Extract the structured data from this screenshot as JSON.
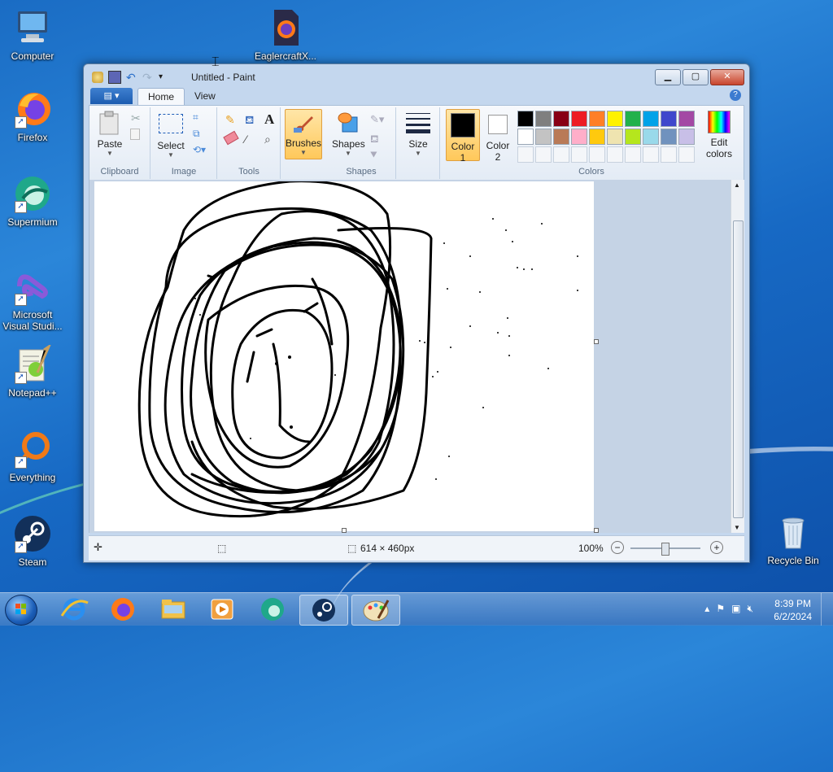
{
  "desktop": {
    "icons": [
      {
        "label": "Computer"
      },
      {
        "label": "EaglercraftX..."
      },
      {
        "label": "Firefox"
      },
      {
        "label": "Supermium"
      },
      {
        "label": "Microsoft Visual Studi..."
      },
      {
        "label": "Notepad++"
      },
      {
        "label": "Everything"
      },
      {
        "label": "Steam"
      },
      {
        "label": "Recycle Bin"
      }
    ]
  },
  "window": {
    "title": "Untitled - Paint",
    "tabs": {
      "file": "▤ ▾",
      "home": "Home",
      "view": "View"
    },
    "ribbon": {
      "clipboard": {
        "paste": "Paste",
        "group": "Clipboard"
      },
      "image": {
        "select": "Select",
        "group": "Image"
      },
      "tools": {
        "group": "Tools"
      },
      "brushes": {
        "label": "Brushes"
      },
      "shapes": {
        "label": "Shapes",
        "group": "Shapes"
      },
      "size": {
        "label": "Size"
      },
      "color1": {
        "label": "Color",
        "num": "1"
      },
      "color2": {
        "label": "Color",
        "num": "2"
      },
      "colors": {
        "group": "Colors",
        "edit": "Edit",
        "edit2": "colors"
      }
    },
    "palette_row1": [
      "#000000",
      "#7f7f7f",
      "#880015",
      "#ed1c24",
      "#ff7f27",
      "#fff200",
      "#22b14c",
      "#00a2e8",
      "#3f48cc",
      "#a349a4"
    ],
    "palette_row2": [
      "#ffffff",
      "#c3c3c3",
      "#b97a57",
      "#ffaec9",
      "#ffc90e",
      "#efe4b0",
      "#b5e61d",
      "#99d9ea",
      "#7092be",
      "#c8bfe7"
    ],
    "status": {
      "dimensions": "614 × 460px",
      "zoom": "100%"
    }
  },
  "taskbar": {
    "time": "8:39 PM",
    "date": "6/2/2024"
  }
}
